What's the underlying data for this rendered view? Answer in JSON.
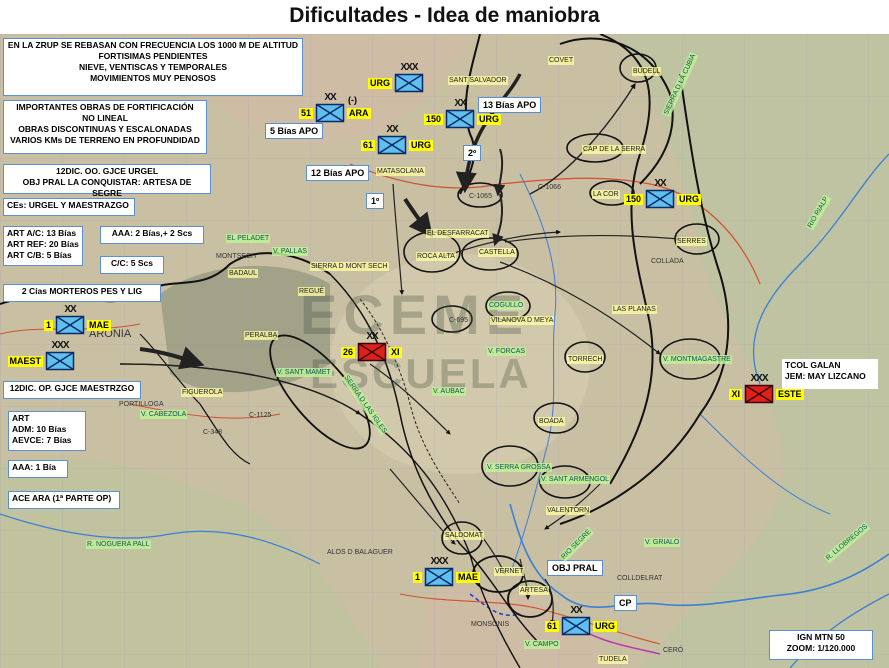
{
  "title": "Dificultades - Idea de maniobra",
  "info_boxes": {
    "terrain": [
      "EN LA ZRUP SE REBASAN CON FRECUENCIA LOS 1000 M DE ALTITUD",
      "FORTISIMAS PENDIENTES",
      "NIEVE, VENTISCAS Y TEMPORALES",
      "MOVIMIENTOS MUY PENOSOS"
    ],
    "fortifications": [
      "IMPORTANTES OBRAS DE FORTIFICACIÓN",
      "NO LINEAL",
      "OBRAS DISCONTINUAS Y ESCALONADAS",
      "VARIOS KMs DE TERRENO EN PROFUNDIDAD"
    ],
    "urgel_division": [
      "12DIC. OO. GJCE URGEL",
      "OBJ PRAL  LA CONQUISTAR: ARTESA DE SEGRE"
    ],
    "ces": "CEs: URGEL Y MAESTRAZGO",
    "art": [
      "ART A/C: 13 Bías",
      "ART REF: 20 Bías",
      "ART C/B: 5 Bías"
    ],
    "aaa": "AAA: 2 Bías,+ 2 Scs",
    "cc": "C/C: 5 Scs",
    "morteros": "2 Cías MORTEROS PES Y LIG",
    "maestrzgo_division": "12DIC. OP. GJCE MAESTRZGO",
    "art2": [
      "ART",
      "ADM: 10 Bías",
      "AEVCE: 7 Bías"
    ],
    "aaa2": "AAA: 1 Bía",
    "ace": "ACE ARA (1ª PARTE OP)",
    "ign": [
      "IGN MTN 50",
      "ZOOM: 1/120.000"
    ],
    "tcol": [
      "TCOL GALAN",
      "JEM: MAY LIZCANO"
    ]
  },
  "callouts": {
    "apo13": "13 Bías APO",
    "apo5": "5 Bías APO",
    "apo12": "12 Bías APO",
    "first": "1º",
    "second": "2º",
    "obj": "OBJ PRAL",
    "cp": "CP",
    "minus": "(-)"
  },
  "units": [
    {
      "id": "urg-top",
      "name": "URG",
      "number": "",
      "side": "friendly",
      "echelon": "XXX"
    },
    {
      "id": "ara",
      "name": "ARA",
      "number": "51",
      "side": "friendly",
      "echelon": "XX"
    },
    {
      "id": "urg-61",
      "name": "URG",
      "number": "61",
      "side": "friendly",
      "echelon": "XX"
    },
    {
      "id": "urg-150a",
      "name": "URG",
      "number": "150",
      "side": "friendly",
      "echelon": "XX"
    },
    {
      "id": "urg-150b",
      "name": "URG",
      "number": "150",
      "side": "friendly",
      "echelon": "XX"
    },
    {
      "id": "mae-1",
      "name": "MAE",
      "number": "1",
      "side": "friendly",
      "echelon": "XX"
    },
    {
      "id": "maest",
      "name": "MAEST",
      "number": "",
      "side": "friendly",
      "echelon": "XXX"
    },
    {
      "id": "xi-26",
      "name": "XI",
      "number": "26",
      "side": "enemy",
      "echelon": "XX"
    },
    {
      "id": "este",
      "name": "ESTE",
      "number": "XI",
      "side": "enemy",
      "echelon": "XXX"
    },
    {
      "id": "mae-1b",
      "name": "MAE",
      "number": "1",
      "side": "friendly",
      "echelon": "XXX"
    },
    {
      "id": "urg-61b",
      "name": "URG",
      "number": "61",
      "side": "friendly",
      "echelon": "XX"
    }
  ],
  "places": [
    "COVET",
    "SANT SALVADOR",
    "BUDELL",
    "CAP DE LA SERRA",
    "MATASOLANA",
    "LA COR",
    "C-1065",
    "C-1066",
    "RIO RIALP",
    "EL DESFARRACAT",
    "ROCA ALTA",
    "CASTELLA",
    "SERRES",
    "COLLADA",
    "EL PELADET",
    "V. PALLAS",
    "MONTSECH",
    "BADAUL",
    "SIERRA D MONT SECH",
    "REGUÉ",
    "COGULLO",
    "C-695",
    "VILANOVA D MEYA",
    "LAS PLANAS",
    "ARONIA",
    "PERALBA",
    "V. MONTMAGASTRE",
    "V. SANT MAMET",
    "V. FORCAS",
    "TORRECH",
    "FIGUEROLA",
    "V. AUBAC",
    "PORTILLOGA",
    "V. CABEZOLA",
    "C-1125",
    "C-348",
    "BOADA",
    "V. SERRA GROSSA",
    "V. SANT ARMENGOL",
    "VALENTORN",
    "SALDOMAT",
    "R. NOGUERA PALL",
    "ALOS D BALAGUER",
    "VERNET",
    "ARTESA",
    "RIO SEGRE",
    "V. GRIALO",
    "COLLDELRAT",
    "R. LLOBREGOS",
    "MONSONIS",
    "V. CAMPO",
    "TUDELA",
    "CERÓ",
    "SIERRA D LA CUBIA",
    "SERRA D LAS IGLES"
  ],
  "watermark": [
    "ECEME",
    "ESCUELA"
  ]
}
